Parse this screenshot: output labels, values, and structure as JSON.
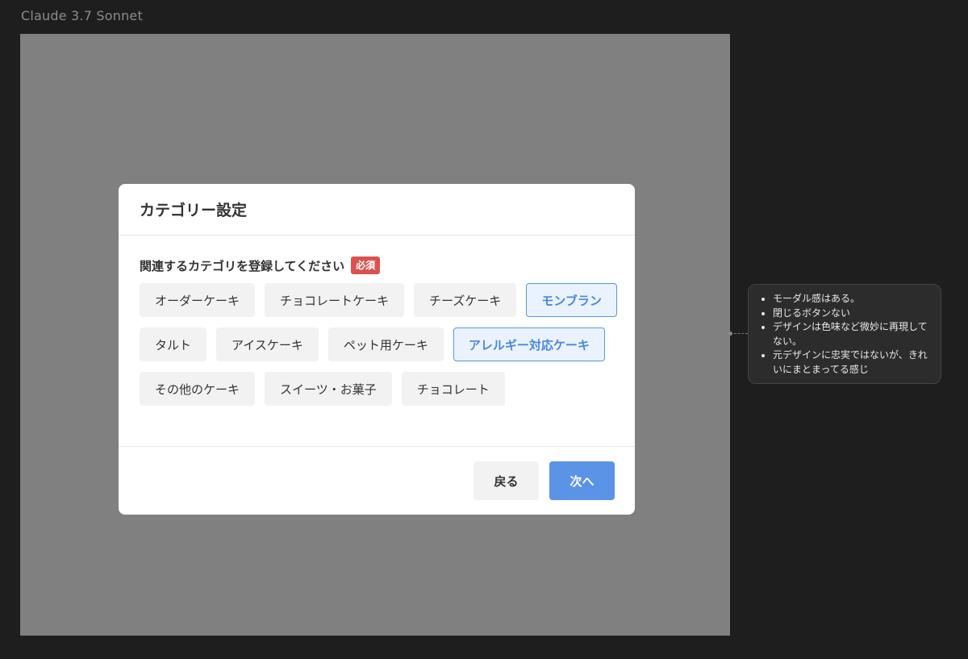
{
  "canvas": {
    "frame_title": "Claude 3.7 Sonnet"
  },
  "modal": {
    "title": "カテゴリー設定",
    "question": "関連するカテゴリを登録してください",
    "required_badge": "必須",
    "categories": [
      {
        "label": "オーダーケーキ",
        "selected": false
      },
      {
        "label": "チョコレートケーキ",
        "selected": false
      },
      {
        "label": "チーズケーキ",
        "selected": false
      },
      {
        "label": "モンブラン",
        "selected": true
      },
      {
        "label": "タルト",
        "selected": false
      },
      {
        "label": "アイスケーキ",
        "selected": false
      },
      {
        "label": "ペット用ケーキ",
        "selected": false
      },
      {
        "label": "アレルギー対応ケーキ",
        "selected": true
      },
      {
        "label": "その他のケーキ",
        "selected": false
      },
      {
        "label": "スイーツ・お菓子",
        "selected": false
      },
      {
        "label": "チョコレート",
        "selected": false
      }
    ],
    "back_label": "戻る",
    "next_label": "次へ"
  },
  "note": {
    "items": [
      "モーダル感はある。",
      "閉じるボタンない",
      "デザインは色味など微妙に再現してない。",
      "元デザインに忠実ではないが、きれいにまとまってる感じ"
    ]
  },
  "colors": {
    "canvas_bg": "#1e1e1e",
    "overlay": "#808080",
    "accent": "#5b93e6",
    "required": "#d9534f",
    "selected_bg": "#eaf3fd"
  }
}
